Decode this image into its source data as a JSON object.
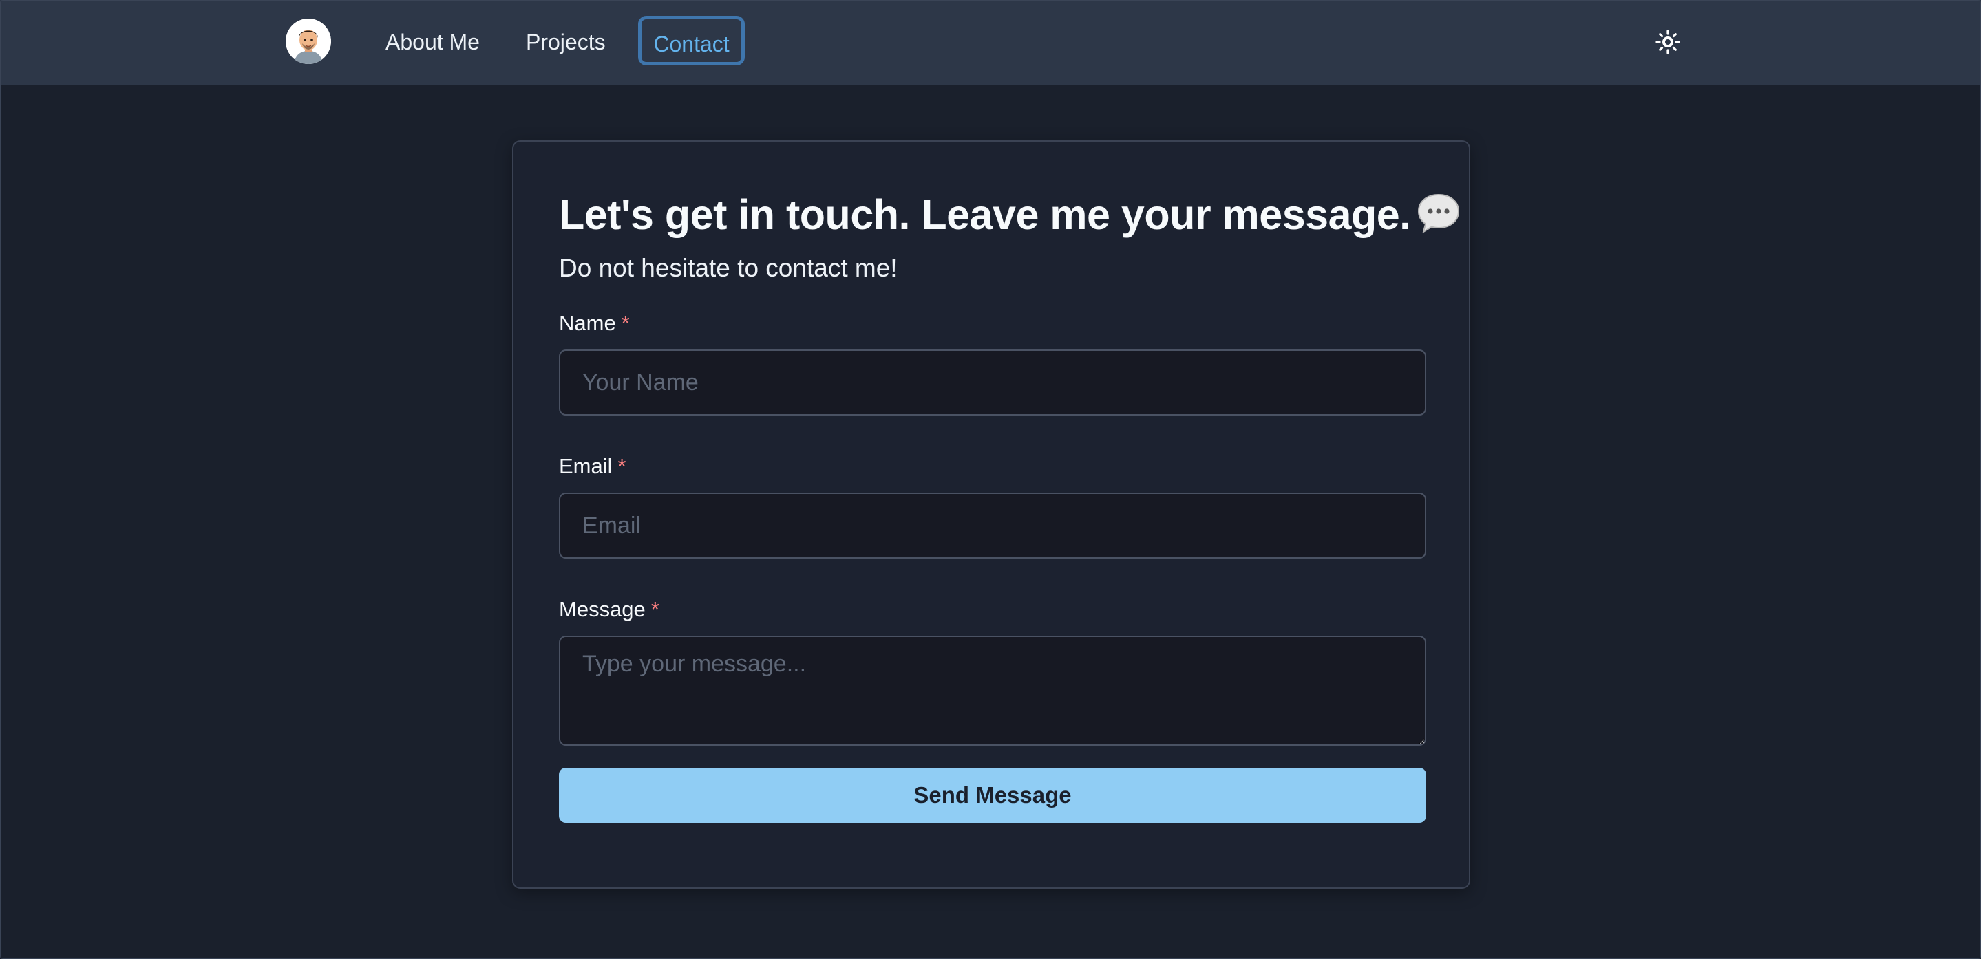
{
  "nav": {
    "avatar_icon": "memoji-avatar-icon",
    "links": [
      {
        "label": "About Me"
      },
      {
        "label": "Projects"
      },
      {
        "label": "Contact",
        "active": true
      }
    ],
    "theme_toggle_icon": "sun-icon"
  },
  "contact": {
    "heading": "Let's get in touch. Leave me your message.",
    "heading_icon": "speech-bubble-icon",
    "subheading": "Do not hesitate to contact me!",
    "name_label": "Name",
    "name_placeholder": "Your Name",
    "email_label": "Email",
    "email_placeholder": "Email",
    "message_label": "Message",
    "message_placeholder": "Type your message...",
    "required_marker": "*",
    "submit_label": "Send Message"
  },
  "colors": {
    "page_background": "#1a202c",
    "navbar_background": "#2d3748",
    "accent": "#63b3ed",
    "button_background": "#90cdf4",
    "required": "#fc8181"
  }
}
